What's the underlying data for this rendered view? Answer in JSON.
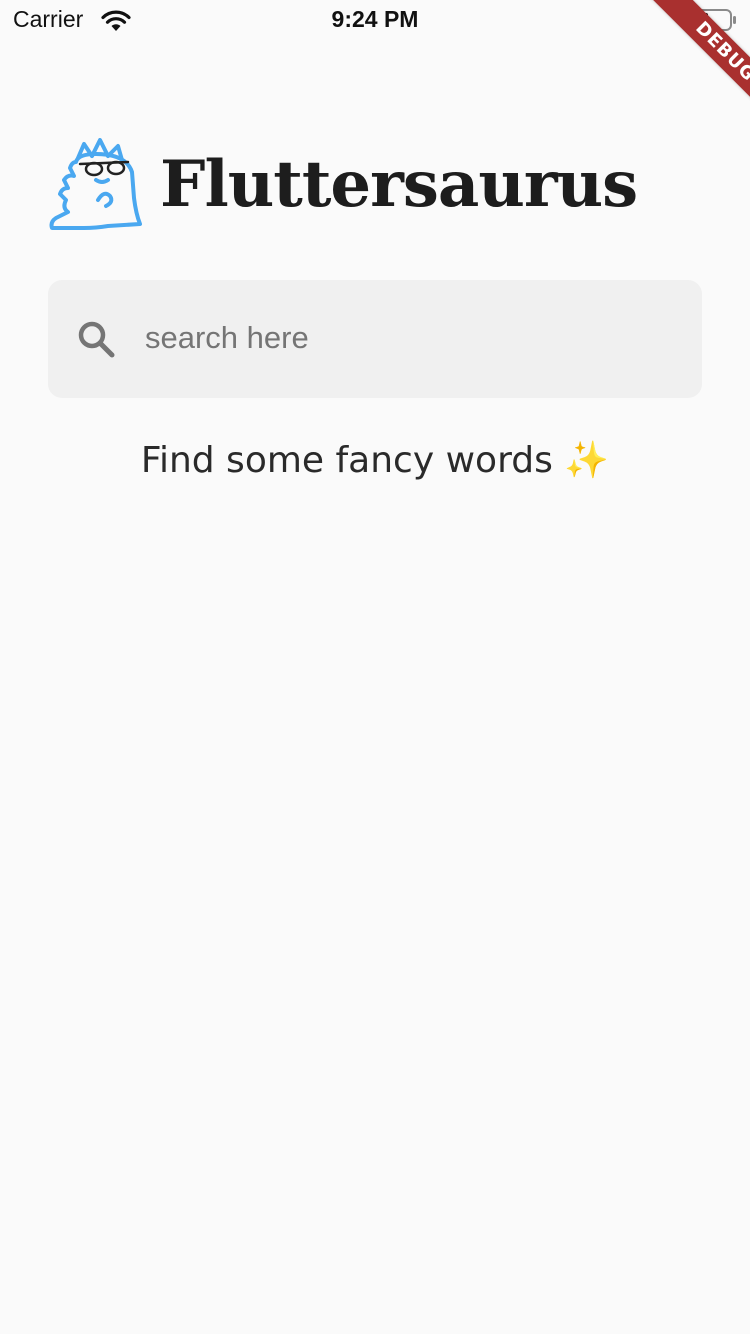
{
  "status_bar": {
    "carrier": "Carrier",
    "time": "9:24 PM",
    "icons": [
      "wifi-icon",
      "battery-icon"
    ]
  },
  "debug_banner": {
    "label": "DEBUG",
    "color": "#a9302f"
  },
  "header": {
    "title": "Fluttersaurus",
    "logo_icon": "dinosaur-with-glasses-icon",
    "logo_color": "#4aa8f0"
  },
  "search": {
    "placeholder": "search here",
    "value": "",
    "icon": "search-icon"
  },
  "hint": {
    "text": "Find some fancy words",
    "emoji": "✨"
  },
  "colors": {
    "background": "#fafafa",
    "search_background": "#f0f0f0",
    "accent": "#4aa8f0"
  }
}
